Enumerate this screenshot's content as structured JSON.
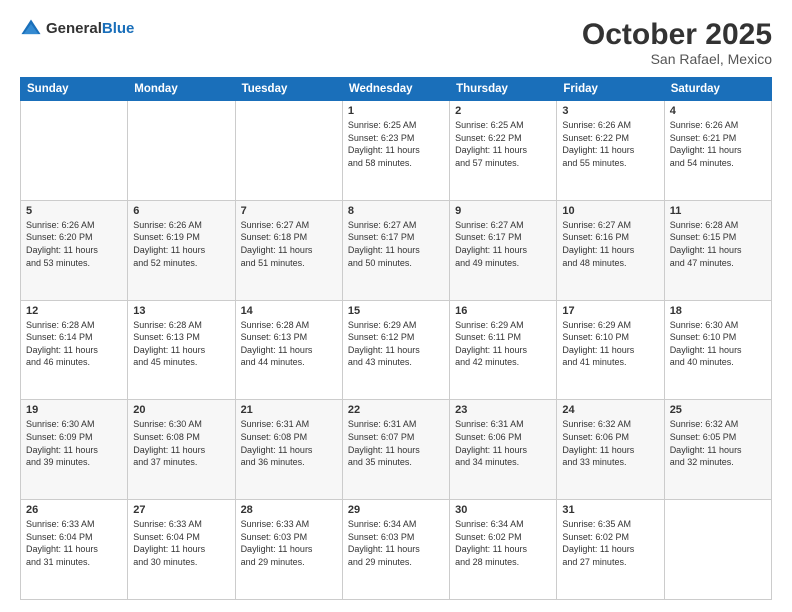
{
  "header": {
    "logo_general": "General",
    "logo_blue": "Blue",
    "month_title": "October 2025",
    "location": "San Rafael, Mexico"
  },
  "days_of_week": [
    "Sunday",
    "Monday",
    "Tuesday",
    "Wednesday",
    "Thursday",
    "Friday",
    "Saturday"
  ],
  "weeks": [
    {
      "days": [
        {
          "num": "",
          "info": ""
        },
        {
          "num": "",
          "info": ""
        },
        {
          "num": "",
          "info": ""
        },
        {
          "num": "1",
          "info": "Sunrise: 6:25 AM\nSunset: 6:23 PM\nDaylight: 11 hours\nand 58 minutes."
        },
        {
          "num": "2",
          "info": "Sunrise: 6:25 AM\nSunset: 6:22 PM\nDaylight: 11 hours\nand 57 minutes."
        },
        {
          "num": "3",
          "info": "Sunrise: 6:26 AM\nSunset: 6:22 PM\nDaylight: 11 hours\nand 55 minutes."
        },
        {
          "num": "4",
          "info": "Sunrise: 6:26 AM\nSunset: 6:21 PM\nDaylight: 11 hours\nand 54 minutes."
        }
      ]
    },
    {
      "days": [
        {
          "num": "5",
          "info": "Sunrise: 6:26 AM\nSunset: 6:20 PM\nDaylight: 11 hours\nand 53 minutes."
        },
        {
          "num": "6",
          "info": "Sunrise: 6:26 AM\nSunset: 6:19 PM\nDaylight: 11 hours\nand 52 minutes."
        },
        {
          "num": "7",
          "info": "Sunrise: 6:27 AM\nSunset: 6:18 PM\nDaylight: 11 hours\nand 51 minutes."
        },
        {
          "num": "8",
          "info": "Sunrise: 6:27 AM\nSunset: 6:17 PM\nDaylight: 11 hours\nand 50 minutes."
        },
        {
          "num": "9",
          "info": "Sunrise: 6:27 AM\nSunset: 6:17 PM\nDaylight: 11 hours\nand 49 minutes."
        },
        {
          "num": "10",
          "info": "Sunrise: 6:27 AM\nSunset: 6:16 PM\nDaylight: 11 hours\nand 48 minutes."
        },
        {
          "num": "11",
          "info": "Sunrise: 6:28 AM\nSunset: 6:15 PM\nDaylight: 11 hours\nand 47 minutes."
        }
      ]
    },
    {
      "days": [
        {
          "num": "12",
          "info": "Sunrise: 6:28 AM\nSunset: 6:14 PM\nDaylight: 11 hours\nand 46 minutes."
        },
        {
          "num": "13",
          "info": "Sunrise: 6:28 AM\nSunset: 6:13 PM\nDaylight: 11 hours\nand 45 minutes."
        },
        {
          "num": "14",
          "info": "Sunrise: 6:28 AM\nSunset: 6:13 PM\nDaylight: 11 hours\nand 44 minutes."
        },
        {
          "num": "15",
          "info": "Sunrise: 6:29 AM\nSunset: 6:12 PM\nDaylight: 11 hours\nand 43 minutes."
        },
        {
          "num": "16",
          "info": "Sunrise: 6:29 AM\nSunset: 6:11 PM\nDaylight: 11 hours\nand 42 minutes."
        },
        {
          "num": "17",
          "info": "Sunrise: 6:29 AM\nSunset: 6:10 PM\nDaylight: 11 hours\nand 41 minutes."
        },
        {
          "num": "18",
          "info": "Sunrise: 6:30 AM\nSunset: 6:10 PM\nDaylight: 11 hours\nand 40 minutes."
        }
      ]
    },
    {
      "days": [
        {
          "num": "19",
          "info": "Sunrise: 6:30 AM\nSunset: 6:09 PM\nDaylight: 11 hours\nand 39 minutes."
        },
        {
          "num": "20",
          "info": "Sunrise: 6:30 AM\nSunset: 6:08 PM\nDaylight: 11 hours\nand 37 minutes."
        },
        {
          "num": "21",
          "info": "Sunrise: 6:31 AM\nSunset: 6:08 PM\nDaylight: 11 hours\nand 36 minutes."
        },
        {
          "num": "22",
          "info": "Sunrise: 6:31 AM\nSunset: 6:07 PM\nDaylight: 11 hours\nand 35 minutes."
        },
        {
          "num": "23",
          "info": "Sunrise: 6:31 AM\nSunset: 6:06 PM\nDaylight: 11 hours\nand 34 minutes."
        },
        {
          "num": "24",
          "info": "Sunrise: 6:32 AM\nSunset: 6:06 PM\nDaylight: 11 hours\nand 33 minutes."
        },
        {
          "num": "25",
          "info": "Sunrise: 6:32 AM\nSunset: 6:05 PM\nDaylight: 11 hours\nand 32 minutes."
        }
      ]
    },
    {
      "days": [
        {
          "num": "26",
          "info": "Sunrise: 6:33 AM\nSunset: 6:04 PM\nDaylight: 11 hours\nand 31 minutes."
        },
        {
          "num": "27",
          "info": "Sunrise: 6:33 AM\nSunset: 6:04 PM\nDaylight: 11 hours\nand 30 minutes."
        },
        {
          "num": "28",
          "info": "Sunrise: 6:33 AM\nSunset: 6:03 PM\nDaylight: 11 hours\nand 29 minutes."
        },
        {
          "num": "29",
          "info": "Sunrise: 6:34 AM\nSunset: 6:03 PM\nDaylight: 11 hours\nand 29 minutes."
        },
        {
          "num": "30",
          "info": "Sunrise: 6:34 AM\nSunset: 6:02 PM\nDaylight: 11 hours\nand 28 minutes."
        },
        {
          "num": "31",
          "info": "Sunrise: 6:35 AM\nSunset: 6:02 PM\nDaylight: 11 hours\nand 27 minutes."
        },
        {
          "num": "",
          "info": ""
        }
      ]
    }
  ]
}
